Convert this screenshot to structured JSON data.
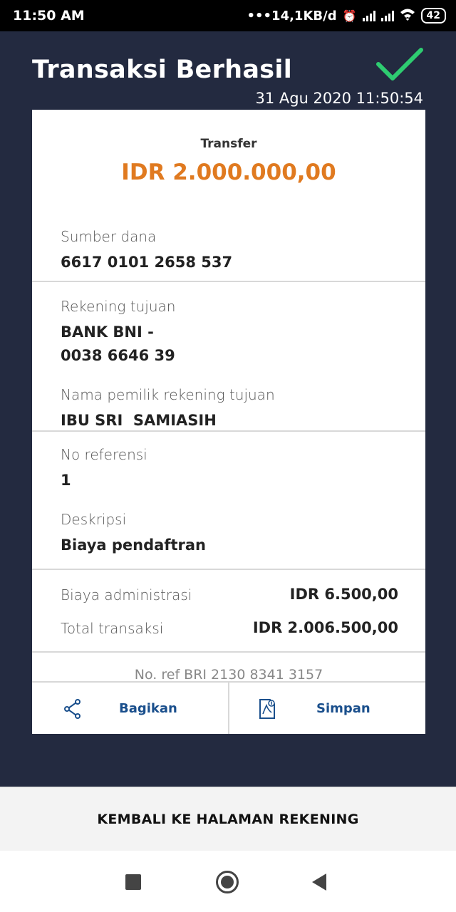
{
  "status_bar": {
    "time": "11:50 AM",
    "network_speed": "14,1KB/d",
    "battery": "42"
  },
  "header": {
    "title": "Transaksi Berhasil",
    "timestamp": "31 Agu 2020 11:50:54",
    "status_icon": "checkmark-icon",
    "accent_color": "#2ecc71"
  },
  "receipt": {
    "type": "Transfer",
    "amount": "IDR 2.000.000,00",
    "amount_color": "#e07a20",
    "source_label": "Sumber dana",
    "source_value": "6617 0101 2658 537",
    "dest_label": "Rekening tujuan",
    "dest_bank": "BANK BNI -",
    "dest_account": "0038 6646 39",
    "owner_label": "Nama pemilik rekening tujuan",
    "owner_value": "IBU SRI  SAMIASIH",
    "ref_label": "No referensi",
    "ref_value": "1",
    "desc_label": "Deskripsi",
    "desc_value": "Biaya pendaftran",
    "admin_label": "Biaya administrasi",
    "admin_value": "IDR 6.500,00",
    "total_label": "Total transaksi",
    "total_value": "IDR 2.006.500,00",
    "bri_ref": "No. ref BRI 2130 8341 3157"
  },
  "actions": {
    "share_label": "Bagikan",
    "save_label": "Simpan"
  },
  "bottom_button": {
    "label": "KEMBALI KE HALAMAN REKENING"
  }
}
